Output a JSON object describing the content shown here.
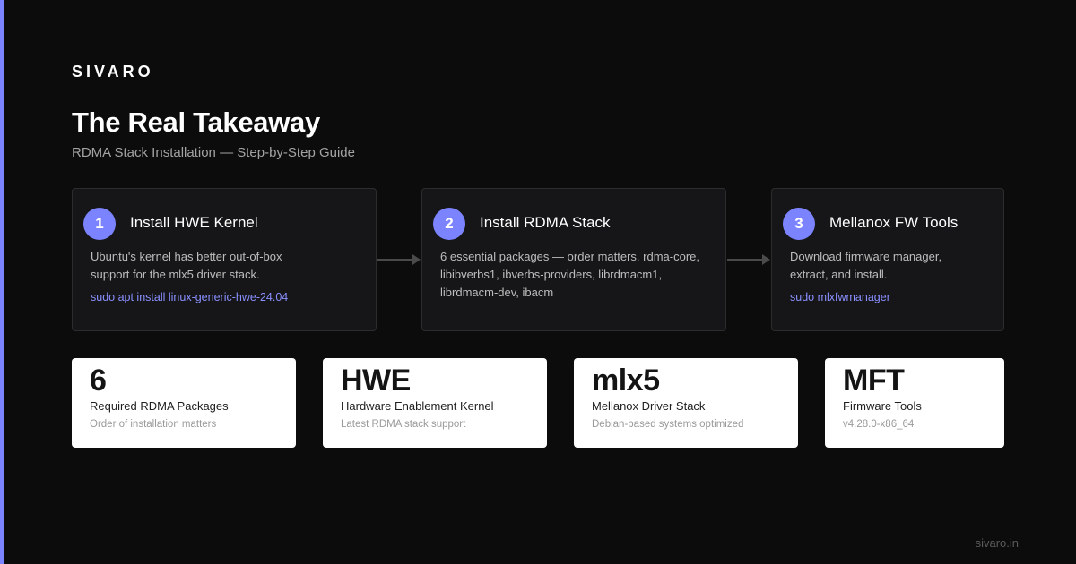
{
  "brand": "SIVARO",
  "title": "The Real Takeaway",
  "subtitle": "RDMA Stack Installation — Step-by-Step Guide",
  "accent_color": "#7c83ff",
  "steps": [
    {
      "number": "1",
      "title": "Install HWE Kernel",
      "description": "Ubuntu's kernel has better out-of-box support for the mlx5 driver stack.",
      "command": "sudo apt install linux-generic-hwe-24.04"
    },
    {
      "number": "2",
      "title": "Install RDMA Stack",
      "description": "6 essential packages — order matters. rdma-core, libibverbs1, ibverbs-providers, librdmacm1, librdmacm-dev, ibacm",
      "command": ""
    },
    {
      "number": "3",
      "title": "Mellanox FW Tools",
      "description": "Download firmware manager, extract, and install.",
      "command": "sudo mlxfwmanager"
    }
  ],
  "stats": [
    {
      "value": "6",
      "label": "Required RDMA Packages",
      "sub": "Order of installation matters"
    },
    {
      "value": "HWE",
      "label": "Hardware Enablement Kernel",
      "sub": "Latest RDMA stack support"
    },
    {
      "value": "mlx5",
      "label": "Mellanox Driver Stack",
      "sub": "Debian-based systems optimized"
    },
    {
      "value": "MFT",
      "label": "Firmware Tools",
      "sub": "v4.28.0-x86_64"
    }
  ],
  "footer": "sivaro.in"
}
